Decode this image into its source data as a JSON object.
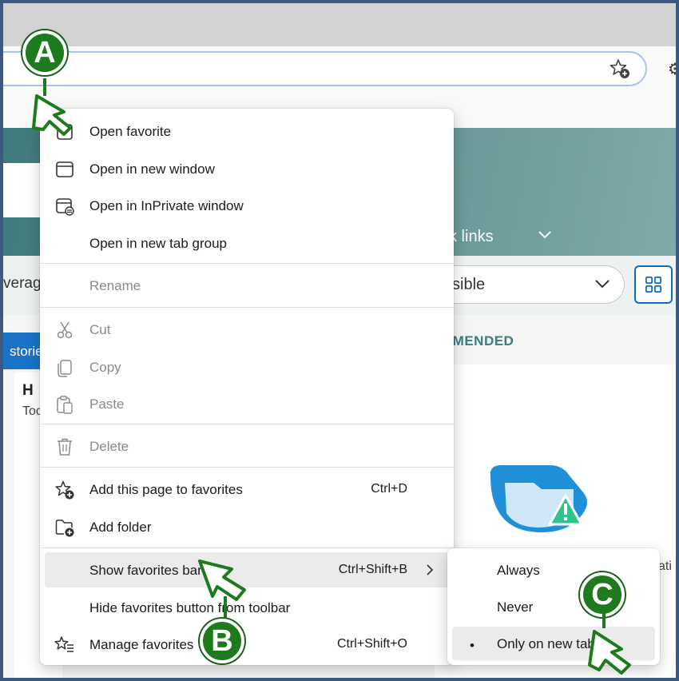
{
  "browser": {
    "favorites_star_icon": "star-add-icon",
    "extensions_icon": "puzzle-icon"
  },
  "newtab": {
    "quick_links_label": "ck links",
    "feed_left_text": "verag",
    "visible_dropdown_label": "sible",
    "stories_tab": "storie",
    "card_heading": "H",
    "card_sub": "Toc",
    "recommended_label": "MMENDED",
    "rec_card_cut_text": "ati"
  },
  "context_menu": {
    "items": [
      {
        "label": "Open favorite",
        "icon": "open-favorite-icon",
        "shortcut": "",
        "disabled": false
      },
      {
        "label": "Open in new window",
        "icon": "window-icon",
        "shortcut": "",
        "disabled": false
      },
      {
        "label": "Open in InPrivate window",
        "icon": "inprivate-icon",
        "shortcut": "",
        "disabled": false
      },
      {
        "label": "Open in new tab group",
        "icon": "",
        "shortcut": "",
        "disabled": false
      },
      {
        "label": "Rename",
        "icon": "",
        "shortcut": "",
        "disabled": true
      },
      {
        "label": "Cut",
        "icon": "scissors-icon",
        "shortcut": "",
        "disabled": true
      },
      {
        "label": "Copy",
        "icon": "copy-icon",
        "shortcut": "",
        "disabled": true
      },
      {
        "label": "Paste",
        "icon": "paste-icon",
        "shortcut": "",
        "disabled": true
      },
      {
        "label": "Delete",
        "icon": "trash-icon",
        "shortcut": "",
        "disabled": true
      },
      {
        "label": "Add this page to favorites",
        "icon": "star-add-icon",
        "shortcut": "Ctrl+D",
        "disabled": false
      },
      {
        "label": "Add folder",
        "icon": "folder-add-icon",
        "shortcut": "",
        "disabled": false
      },
      {
        "label": "Show favorites bar",
        "icon": "",
        "shortcut": "Ctrl+Shift+B",
        "disabled": false,
        "highlighted": true,
        "submenu": true
      },
      {
        "label": "Hide favorites button from toolbar",
        "icon": "",
        "shortcut": "",
        "disabled": false
      },
      {
        "label": "Manage favorites",
        "icon": "manage-favorites-icon",
        "shortcut": "Ctrl+Shift+O",
        "disabled": false
      }
    ]
  },
  "submenu": {
    "items": [
      {
        "label": "Always",
        "selected": false
      },
      {
        "label": "Never",
        "selected": false
      },
      {
        "label": "Only on new tabs",
        "selected": true
      }
    ]
  },
  "annotations": {
    "a": "A",
    "b": "B",
    "c": "C"
  },
  "colors": {
    "annotation_green": "#1d7a1d",
    "frame_border": "#3c5a80",
    "hero_teal": "#3f7a7c",
    "accent_blue": "#0f6cbd"
  }
}
